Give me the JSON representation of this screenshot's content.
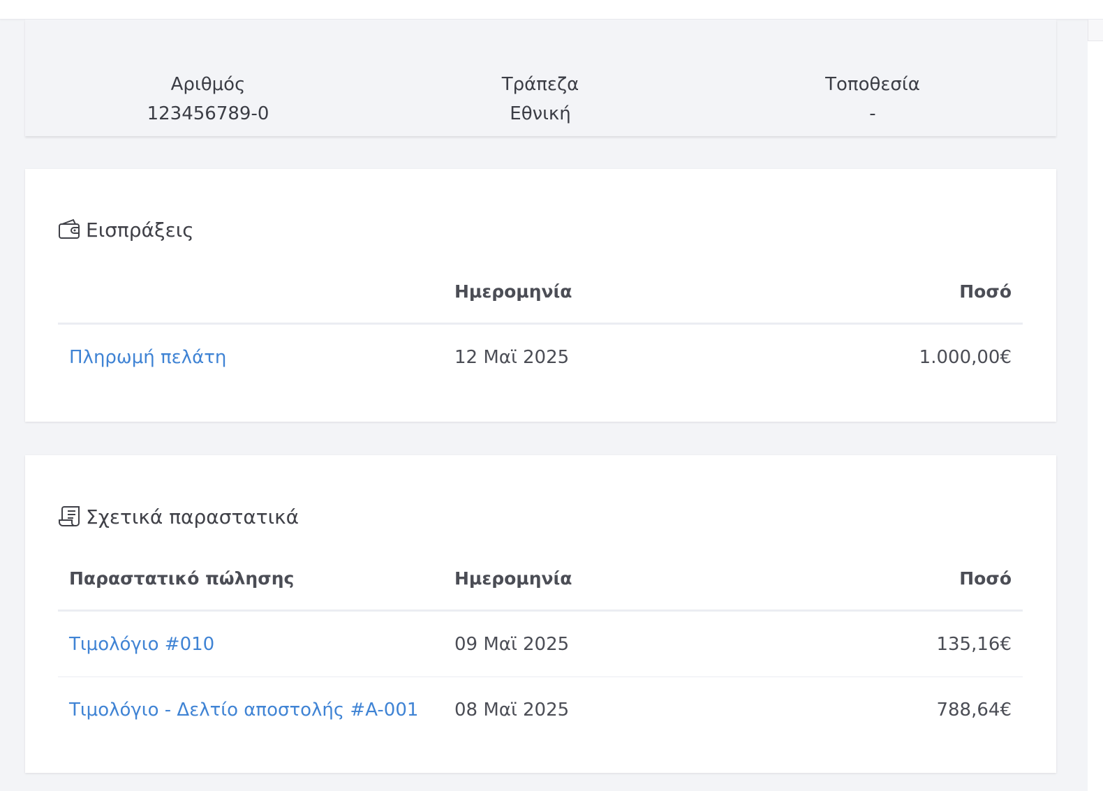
{
  "account": {
    "number_label": "Αριθμός",
    "number_value": "123456789-0",
    "bank_label": "Τράπεζα",
    "bank_value": "Εθνική",
    "location_label": "Τοποθεσία",
    "location_value": "-"
  },
  "receipts": {
    "title": "Εισπράξεις",
    "icon": "wallet-icon",
    "headers": {
      "description": "",
      "date": "Ημερομηνία",
      "amount": "Ποσό"
    },
    "rows": [
      {
        "description": "Πληρωμή πελάτη",
        "date": "12 Μαϊ 2025",
        "amount": "1.000,00€"
      }
    ]
  },
  "documents": {
    "title": "Σχετικά παραστατικά",
    "icon": "scroll-document-icon",
    "headers": {
      "document": "Παραστατικό πώλησης",
      "date": "Ημερομηνία",
      "amount": "Ποσό"
    },
    "rows": [
      {
        "document": "Τιμολόγιο #010",
        "date": "09 Μαϊ 2025",
        "amount": "135,16€"
      },
      {
        "document": "Τιμολόγιο - Δελτίο αποστολής #A-001",
        "date": "08 Μαϊ 2025",
        "amount": "788,64€"
      }
    ]
  },
  "colors": {
    "link": "#3f83d4",
    "text": "#3f4047",
    "background": "#f3f4f7",
    "card": "#ffffff"
  }
}
